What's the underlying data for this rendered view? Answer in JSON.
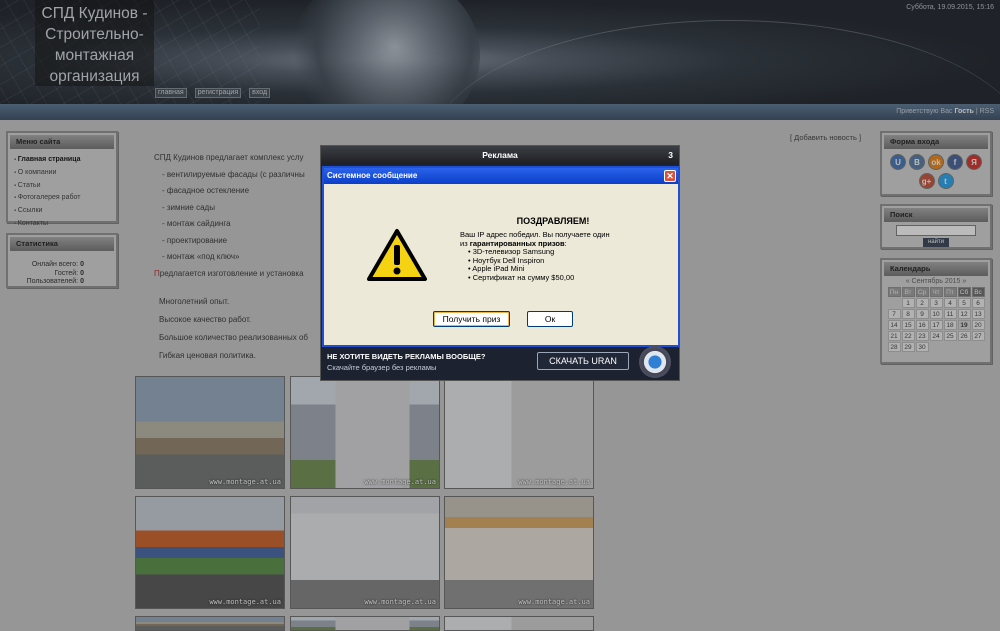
{
  "header": {
    "site_title": "СПД Кудинов - Строительно-монтажная организация",
    "datetime": "Суббота, 19.09.2015, 15:16",
    "nav": [
      "главная",
      "регистрация",
      "вход"
    ],
    "greeting_prefix": "Приветствую Вас",
    "greeting_user": "Гость",
    "rss": "RSS"
  },
  "left": {
    "menu_title": "Меню сайта",
    "menu": [
      "Главная страница",
      "О компании",
      "Статьи",
      "Фотогалерея работ",
      "Ссылки",
      "Контакты"
    ],
    "stats_title": "Статистика",
    "stats": [
      {
        "label": "Онлайн всего:",
        "value": "0"
      },
      {
        "label": "Гостей:",
        "value": "0"
      },
      {
        "label": "Пользователей:",
        "value": "0"
      }
    ]
  },
  "right": {
    "login_title": "Форма входа",
    "social": [
      {
        "icon": "ucoz-icon",
        "glyph": "U",
        "color": "#3b6fb6"
      },
      {
        "icon": "vk-icon",
        "glyph": "B",
        "color": "#4c75a3"
      },
      {
        "icon": "odnoklassniki-icon",
        "glyph": "ok",
        "color": "#ee8208"
      },
      {
        "icon": "facebook-icon",
        "glyph": "f",
        "color": "#3b5998"
      },
      {
        "icon": "yandex-icon",
        "glyph": "Я",
        "color": "#d8251e"
      },
      {
        "icon": "google-plus-icon",
        "glyph": "g+",
        "color": "#c6492f"
      },
      {
        "icon": "twitter-icon",
        "glyph": "t",
        "color": "#1da1f2"
      }
    ],
    "search_title": "Поиск",
    "search_button": "найти",
    "calendar_title": "Календарь",
    "calendar_month": "« Сентябрь 2015 »",
    "weekdays": [
      "Пн",
      "Вт",
      "Ср",
      "Чт",
      "Пт",
      "Сб",
      "Вс"
    ],
    "first_weekday_offset": 1,
    "days_in_month": 30,
    "today": 19
  },
  "main": {
    "add_news": "[ Добавить новость ]",
    "intro": "СПД Кудинов предлагает комплекс услу",
    "services": [
      "- вентилируемые фасады (с различны",
      "- фасадное остекление",
      "- зимние сады",
      "- монтаж сайдинга",
      "- проектирование",
      "- монтаж «под ключ»"
    ],
    "offer": "Предлагается изготовление и установка",
    "advantages": [
      "Многолетний опыт.",
      "Высокое качество работ.",
      "Большое количество реализованных об",
      "Гибкая ценовая политика."
    ],
    "watermark": "www.montage.at.ua"
  },
  "ad": {
    "bar_title": "Реклама",
    "countdown": "3",
    "dialog_title": "Системное сообщение",
    "heading": "ПОЗДРАВЛЯЕМ!",
    "line1": "Ваш IP адрес победил. Вы получаете один",
    "line2_prefix": "из ",
    "line2_bold": "гарантированных призов",
    "line2_suffix": ":",
    "prizes": [
      "3D-телевизор Samsung",
      "Ноутбук Dell Inspiron",
      "Apple iPad Mini",
      "Сертификат на сумму $50,00"
    ],
    "btn_prize": "Получить приз",
    "btn_ok": "Ок",
    "footer_heading": "НЕ ХОТИТЕ ВИДЕТЬ РЕКЛАМЫ ВООБЩЕ?",
    "footer_sub": "Скачайте браузер без рекламы",
    "download": "СКАЧАТЬ URAN"
  }
}
